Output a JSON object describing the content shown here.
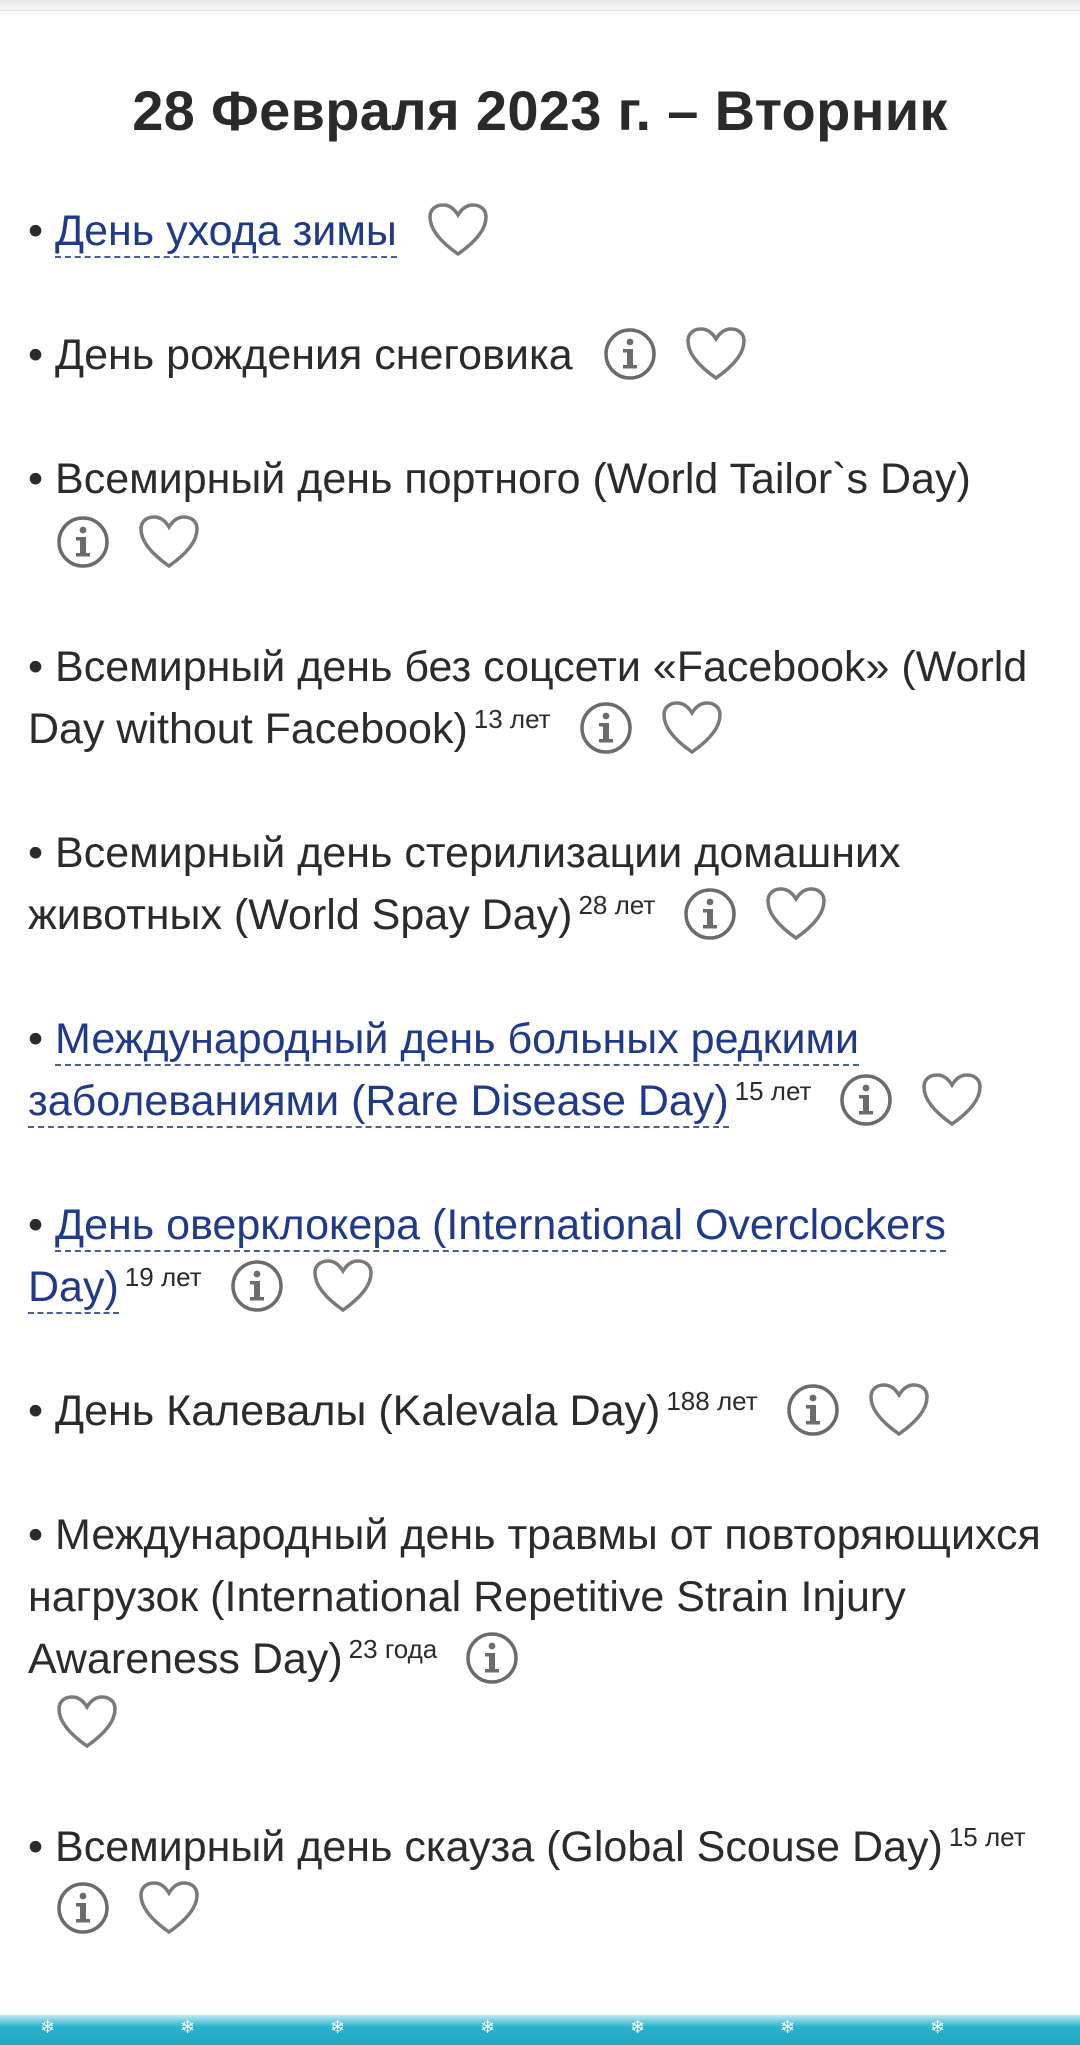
{
  "page": {
    "title": "28 Февраля 2023 г. – Вторник"
  },
  "bullet": "•",
  "holidays": [
    {
      "label": "День ухода зимы",
      "link": true,
      "age": "",
      "info": false
    },
    {
      "label": "День рождения снеговика",
      "link": false,
      "age": "",
      "info": true
    },
    {
      "label": "Всемирный день портного (World Tailor`s Day)",
      "link": false,
      "age": "",
      "info": true
    },
    {
      "label": "Всемирный день без соцсети «Facebook» (World Day without Facebook)",
      "link": false,
      "age": "13 лет",
      "info": true
    },
    {
      "label": "Всемирный день стерилизации домашних животных (World Spay Day)",
      "link": false,
      "age": "28 лет",
      "info": true
    },
    {
      "label": "Международный день больных редкими заболеваниями (Rare Disease Day)",
      "link": true,
      "age": "15 лет",
      "info": true
    },
    {
      "label": "День оверклокера (International Overclockers Day)",
      "link": true,
      "age": "19 лет",
      "info": true
    },
    {
      "label": "День Калевалы (Kalevala Day)",
      "link": false,
      "age": "188 лет",
      "info": true
    },
    {
      "label": "Международный день травмы от повторяющихся нагрузок (International Repetitive Strain Injury Awareness Day)",
      "link": false,
      "age": "23 года",
      "info": true
    },
    {
      "label": "Всемирный день скауза (Global Scouse Day)",
      "link": false,
      "age": "15 лет",
      "info": true
    }
  ],
  "icons": {
    "info": "info-icon",
    "favorite": "heart-icon"
  },
  "colors": {
    "link": "#1f3a8a",
    "text": "#2b2b2b",
    "icon": "#6b6b6b",
    "footer": "#27b3cc"
  }
}
